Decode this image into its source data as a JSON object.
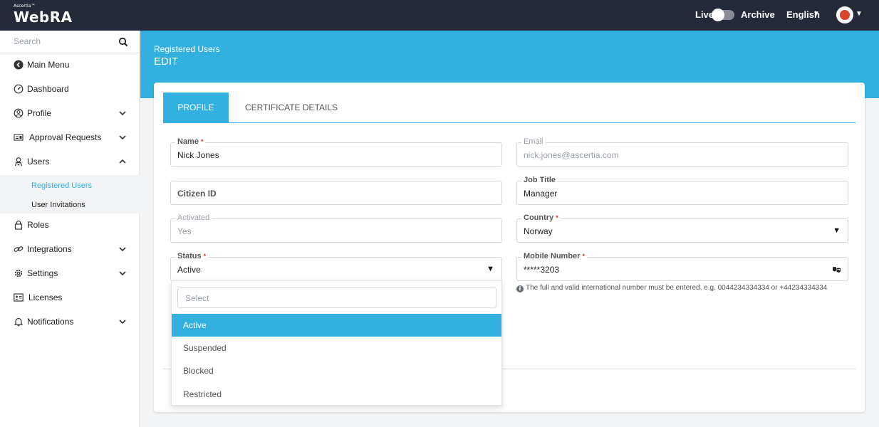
{
  "topbar": {
    "logo_small": "Ascertia™",
    "logo_big": "WebRA",
    "live_label": "Live",
    "archive_label": "Archive",
    "language": "English"
  },
  "sidebar": {
    "search_placeholder": "Search",
    "items": [
      {
        "label": "Main Menu",
        "icon": "back-circle-icon"
      },
      {
        "label": "Dashboard",
        "icon": "dashboard-icon"
      },
      {
        "label": "Profile",
        "icon": "user-circle-icon",
        "expandable": true
      },
      {
        "label": "Approval Requests",
        "icon": "id-card-icon",
        "expandable": true
      },
      {
        "label": "Users",
        "icon": "users-icon",
        "expanded": true
      },
      {
        "label": "Roles",
        "icon": "lock-icon"
      },
      {
        "label": "Integrations",
        "icon": "link-icon",
        "expandable": true
      },
      {
        "label": "Settings",
        "icon": "gear-icon",
        "expandable": true
      },
      {
        "label": "Licenses",
        "icon": "license-icon"
      },
      {
        "label": "Notifications",
        "icon": "bell-icon",
        "expandable": true
      }
    ],
    "sub_items": [
      {
        "label": "Registered Users",
        "active": true
      },
      {
        "label": "User Invitations",
        "active": false
      }
    ]
  },
  "header": {
    "breadcrumb": "Registered Users",
    "title": "EDIT"
  },
  "tabs": {
    "profile": "PROFILE",
    "certificate": "CERTIFICATE DETAILS"
  },
  "form": {
    "name": {
      "label": "Name",
      "value": "Nick Jones"
    },
    "email": {
      "label": "Email",
      "value": "nick.jones@ascertia.com"
    },
    "citizen_id": {
      "label": "Citizen ID"
    },
    "job_title": {
      "label": "Job Title",
      "value": "Manager"
    },
    "activated": {
      "label": "Activated",
      "value": "Yes"
    },
    "country": {
      "label": "Country",
      "value": "Norway"
    },
    "status": {
      "label": "Status",
      "value": "Active"
    },
    "mobile": {
      "label": "Mobile Number",
      "value": "*****3203"
    },
    "required_mark": "*",
    "mobile_hint": "The full and valid international number must be entered, e.g. 0044234334334 or +44234334334"
  },
  "status_dropdown": {
    "search_placeholder": "Select",
    "options": [
      "Active",
      "Suspended",
      "Blocked",
      "Restricted"
    ],
    "selected": "Active"
  },
  "colors": {
    "accent": "#32b1e1",
    "topbar": "#252a3a",
    "required": "#d9332b"
  }
}
